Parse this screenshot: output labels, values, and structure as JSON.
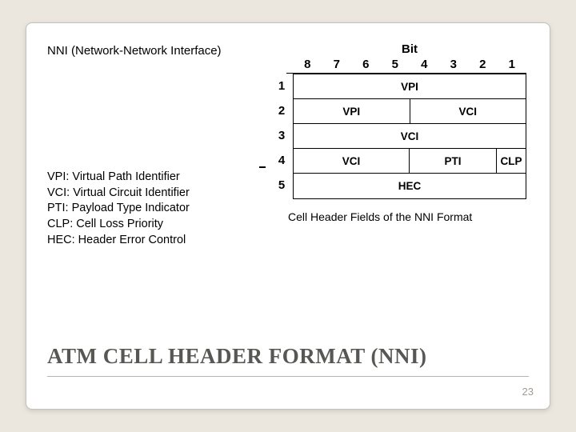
{
  "heading": "NNI (Network-Network Interface)",
  "defs": [
    "VPI: Virtual Path Identifier",
    "VCI: Virtual Circuit Identifier",
    "PTI: Payload Type Indicator",
    "CLP: Cell Loss Priority",
    "HEC: Header Error Control"
  ],
  "diagram": {
    "bit_label": "Bit",
    "bits": [
      "8",
      "7",
      "6",
      "5",
      "4",
      "3",
      "2",
      "1"
    ],
    "row_nums": [
      "1",
      "2",
      "3",
      "4",
      "5"
    ],
    "rows": [
      [
        {
          "span": "c8",
          "label": "VPI"
        }
      ],
      [
        {
          "span": "c4",
          "label": "VPI"
        },
        {
          "span": "c4",
          "label": "VCI"
        }
      ],
      [
        {
          "span": "c8",
          "label": "VCI"
        }
      ],
      [
        {
          "span": "c4",
          "label": "VCI"
        },
        {
          "span": "c3",
          "label": "PTI"
        },
        {
          "span": "c1",
          "label": "CLP"
        }
      ],
      [
        {
          "span": "c8",
          "label": "HEC"
        }
      ]
    ],
    "caption": "Cell Header Fields of the NNI Format"
  },
  "title": "ATM CELL HEADER FORMAT (NNI)",
  "page": "23"
}
